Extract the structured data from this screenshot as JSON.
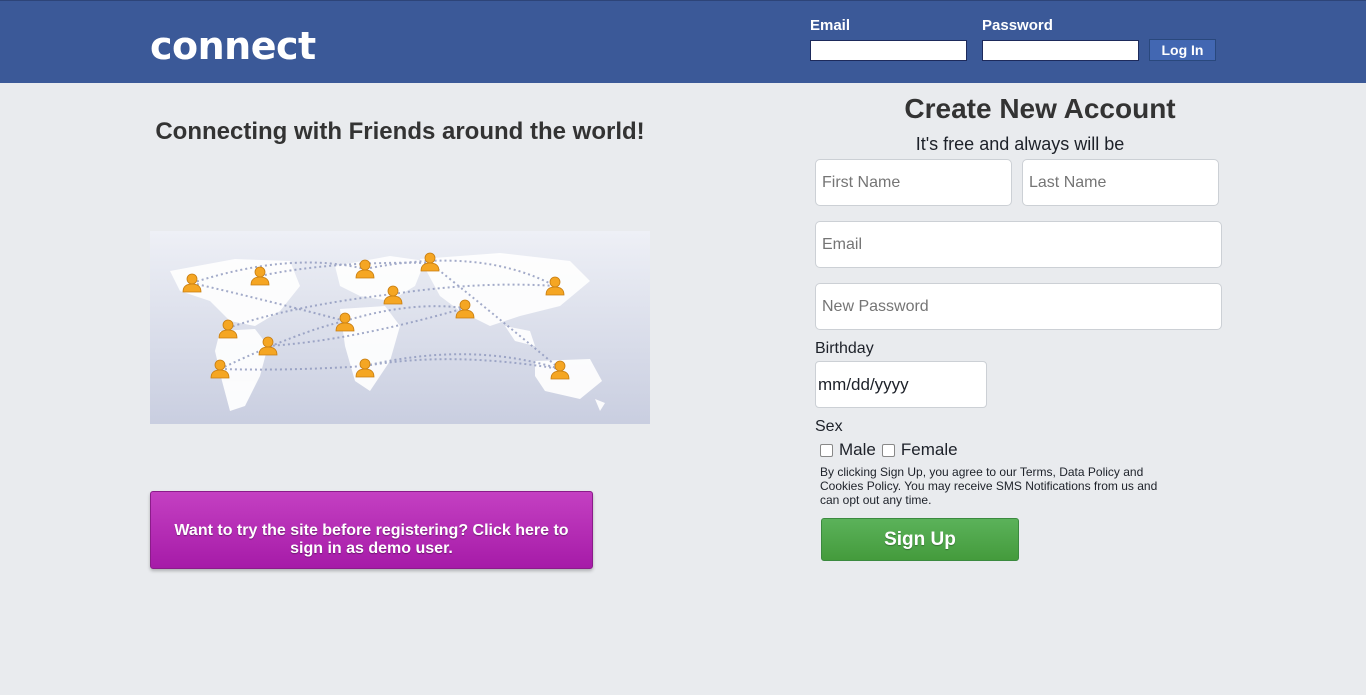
{
  "header": {
    "logo": "connect",
    "email_label": "Email",
    "password_label": "Password",
    "email_value": "",
    "password_value": "",
    "login_label": "Log In",
    "bg_color": "#3b5998"
  },
  "left": {
    "tagline": "Connecting with Friends around the world!",
    "demo_button": "Want to try the site before registering? Click here to sign in as demo user.",
    "demo_color": "#b62cb6"
  },
  "signup": {
    "title": "Create New Account",
    "subtitle": "It's free and always will be",
    "first_name_placeholder": "First Name",
    "last_name_placeholder": "Last Name",
    "email_placeholder": "Email",
    "password_placeholder": "New Password",
    "birthday_label": "Birthday",
    "birthday_value": "mm/dd/yyyy",
    "sex_label": "Sex",
    "male_label": "Male",
    "female_label": "Female",
    "terms": "By clicking Sign Up, you agree to our Terms, Data Policy and Cookies Policy. You may receive SMS Notifications from us and can opt out any time.",
    "signup_button": "Sign Up",
    "signup_color": "#4caa47"
  }
}
